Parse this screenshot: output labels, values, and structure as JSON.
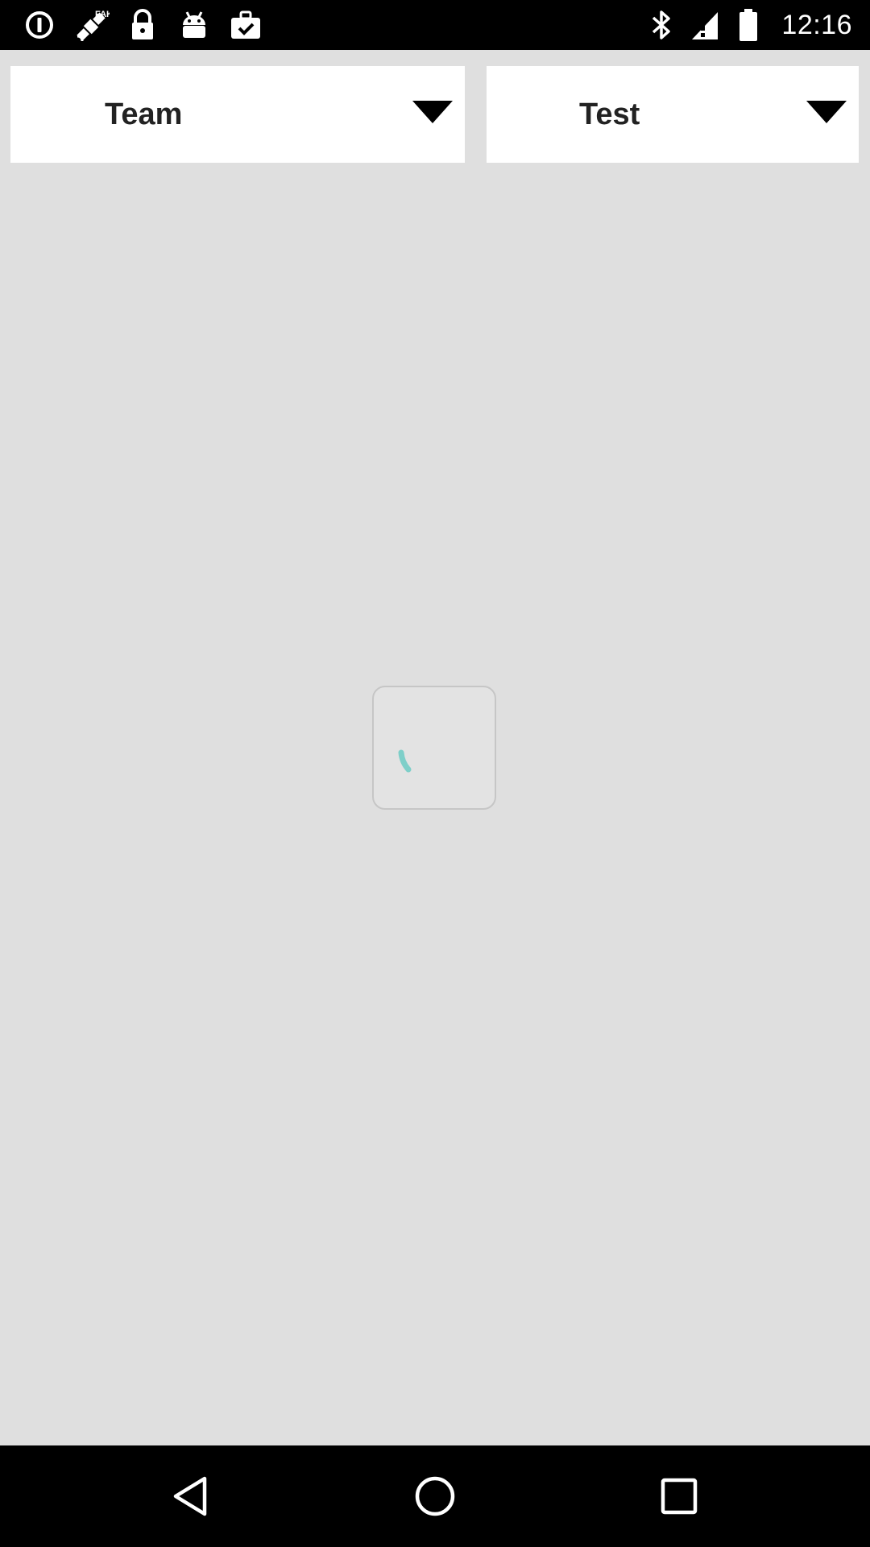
{
  "status_bar": {
    "time": "12:16",
    "left_icons": [
      "info-icon",
      "fake-gps-satellite-icon",
      "lock-icon",
      "android-icon",
      "briefcase-check-icon"
    ],
    "right_icons": [
      "bluetooth-icon",
      "signal-alert-icon",
      "battery-icon"
    ]
  },
  "filters": {
    "team": {
      "label": "Team"
    },
    "test": {
      "label": "Test"
    }
  },
  "loader": {
    "color": "#7ecfc9"
  },
  "nav_bar": {
    "buttons": [
      "back",
      "home",
      "recent-apps"
    ]
  }
}
